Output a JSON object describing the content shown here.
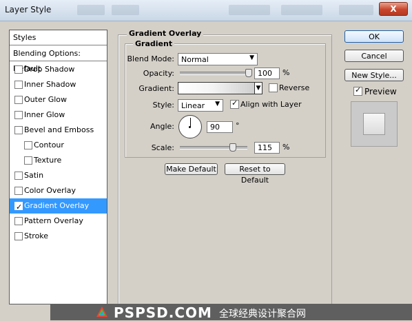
{
  "window": {
    "title": "Layer Style",
    "close_label": "X"
  },
  "styles_panel": {
    "header": "Styles",
    "blending_options": "Blending Options: Default",
    "items": [
      {
        "label": "Drop Shadow",
        "checked": false,
        "selected": false,
        "indent": 0
      },
      {
        "label": "Inner Shadow",
        "checked": false,
        "selected": false,
        "indent": 0
      },
      {
        "label": "Outer Glow",
        "checked": false,
        "selected": false,
        "indent": 0
      },
      {
        "label": "Inner Glow",
        "checked": false,
        "selected": false,
        "indent": 0
      },
      {
        "label": "Bevel and Emboss",
        "checked": false,
        "selected": false,
        "indent": 0
      },
      {
        "label": "Contour",
        "checked": false,
        "selected": false,
        "indent": 1
      },
      {
        "label": "Texture",
        "checked": false,
        "selected": false,
        "indent": 1
      },
      {
        "label": "Satin",
        "checked": false,
        "selected": false,
        "indent": 0
      },
      {
        "label": "Color Overlay",
        "checked": false,
        "selected": false,
        "indent": 0
      },
      {
        "label": "Gradient Overlay",
        "checked": true,
        "selected": true,
        "indent": 0
      },
      {
        "label": "Pattern Overlay",
        "checked": false,
        "selected": false,
        "indent": 0
      },
      {
        "label": "Stroke",
        "checked": false,
        "selected": false,
        "indent": 0
      }
    ]
  },
  "gradient_overlay": {
    "section_title": "Gradient Overlay",
    "group_title": "Gradient",
    "blend_mode_label": "Blend Mode:",
    "blend_mode_value": "Normal",
    "opacity_label": "Opacity:",
    "opacity_value": "100",
    "opacity_unit": "%",
    "opacity_fraction": 1.0,
    "gradient_label": "Gradient:",
    "reverse_label": "Reverse",
    "reverse_checked": false,
    "style_label": "Style:",
    "style_value": "Linear",
    "align_label": "Align with Layer",
    "align_checked": true,
    "angle_label": "Angle:",
    "angle_value": "90",
    "angle_unit": "°",
    "scale_label": "Scale:",
    "scale_value": "115",
    "scale_unit": "%",
    "scale_fraction": 0.77,
    "make_default_label": "Make Default",
    "reset_default_label": "Reset to Default"
  },
  "actions": {
    "ok_label": "OK",
    "cancel_label": "Cancel",
    "new_style_label": "New Style...",
    "preview_label": "Preview",
    "preview_checked": true
  },
  "watermark": {
    "site": "PSPSD.COM",
    "tagline": "全球经典设计聚合网"
  },
  "colors": {
    "selection": "#3399ff",
    "dialog_bg": "#d4d0c8",
    "close_button": "#c9452d"
  }
}
